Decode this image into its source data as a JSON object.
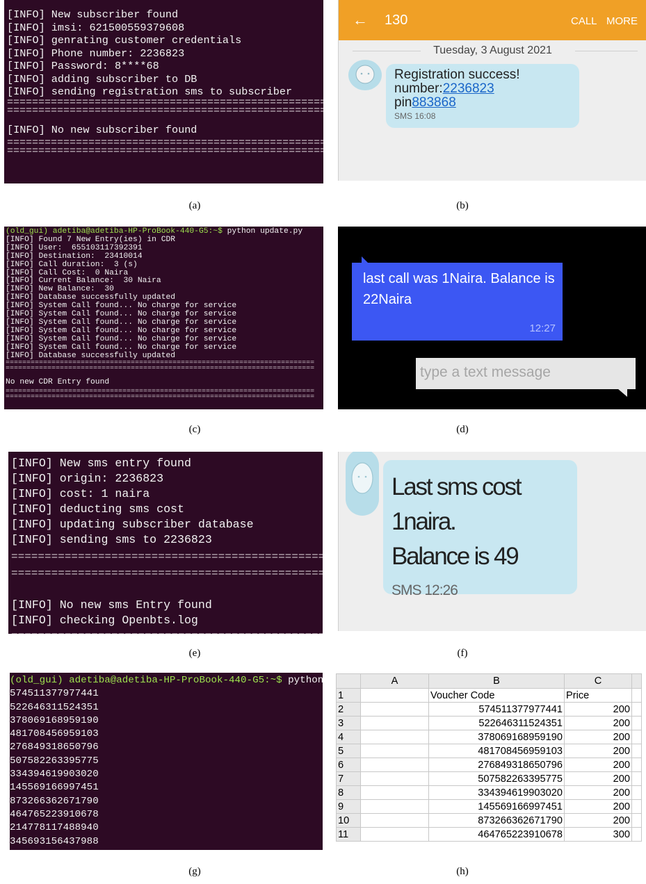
{
  "panel_a": {
    "lines": [
      "[INFO] New subscriber found",
      "[INFO] imsi: 621500559379608",
      "[INFO] genrating customer credentials",
      "[INFO] Phone number: 2236823",
      "[INFO] Password: 8****68",
      "[INFO] adding subscriber to DB",
      "[INFO] sending registration sms to subscriber"
    ],
    "after_separator": "[INFO] No new subscriber found"
  },
  "panel_b": {
    "sender": "130",
    "call_label": "CALL",
    "more_label": "MORE",
    "date": "Tuesday, 3 August 2021",
    "message_title": "Registration success!",
    "number_label": "number:",
    "number_value": "2236823",
    "pin_label": "pin",
    "pin_value": "883868",
    "sms_time": "SMS 16:08"
  },
  "panel_c": {
    "prompt_env": "(old_gui)",
    "prompt_user": "adetiba@adetiba-HP-ProBook-440-G5:~$",
    "command": "python update.py",
    "lines": [
      "[INFO] Found 7 New Entry(ies) in CDR",
      "[INFO] User:  655103117392391",
      "[INFO] Destination:  23410014",
      "[INFO] Call duration:  3 (s)",
      "[INFO] Call Cost:  0 Naira",
      "[INFO] Current Balance:  30 Naira",
      "[INFO] New Balance:  30",
      "[INFO] Database successfully updated",
      "[INFO] System Call found... No charge for service",
      "[INFO] System Call found... No charge for service",
      "[INFO] System Call found... No charge for service",
      "[INFO] System Call found... No charge for service",
      "[INFO] System Call found... No charge for service",
      "[INFO] System Call found... No charge for service",
      "[INFO] Database successfully updated"
    ],
    "after_separator": "No new CDR Entry found"
  },
  "panel_d": {
    "message": "last call was 1Naira. Balance is 22Naira",
    "time": "12:27",
    "input_placeholder": "type a text message"
  },
  "panel_e": {
    "lines": [
      "[INFO] New sms entry found",
      "[INFO] origin: 2236823",
      "[INFO] cost: 1 naira",
      "[INFO] deducting sms cost",
      "[INFO] updating subscriber database",
      "[INFO] sending sms to 2236823"
    ],
    "after_separator": [
      "[INFO] No new sms Entry found",
      "[INFO] checking Openbts.log"
    ]
  },
  "panel_f": {
    "message_line1": "Last sms cost 1naira.",
    "message_line2": "Balance is 49",
    "sms_time": "SMS 12:26"
  },
  "panel_g": {
    "prompt_env": "(old_gui)",
    "prompt_user": "adetiba@adetiba-HP-ProBook-440-G5:~$",
    "command": "python",
    "codes": [
      "574511377977441",
      "522646311524351",
      "378069168959190",
      "481708456959103",
      "276849318650796",
      "507582263395775",
      "334394619903020",
      "145569166997451",
      "873266362671790",
      "464765223910678",
      "214778117488940",
      "345693156437988"
    ]
  },
  "panel_h": {
    "columns": [
      "A",
      "B",
      "C"
    ],
    "header_row": {
      "num": "1",
      "b": "Voucher Code",
      "c": "Price"
    },
    "rows": [
      {
        "num": "2",
        "code": "574511377977441",
        "price": "200"
      },
      {
        "num": "3",
        "code": "522646311524351",
        "price": "200"
      },
      {
        "num": "4",
        "code": "378069168959190",
        "price": "200"
      },
      {
        "num": "5",
        "code": "481708456959103",
        "price": "200"
      },
      {
        "num": "6",
        "code": "276849318650796",
        "price": "200"
      },
      {
        "num": "7",
        "code": "507582263395775",
        "price": "200"
      },
      {
        "num": "8",
        "code": "334394619903020",
        "price": "200"
      },
      {
        "num": "9",
        "code": "145569166997451",
        "price": "200"
      },
      {
        "num": "10",
        "code": "873266362671790",
        "price": "200"
      },
      {
        "num": "11",
        "code": "464765223910678",
        "price": "300"
      }
    ]
  },
  "captions": {
    "a": "(a)",
    "b": "(b)",
    "c": "(c)",
    "d": "(d)",
    "e": "(e)",
    "f": "(f)",
    "g": "(g)",
    "h": "(h)"
  },
  "colors": {
    "terminal_bg": "#2d0a24",
    "prompt_green": "#9ee04f",
    "appbar_orange": "#f0a026",
    "bubble_blue": "#c8e7f1",
    "dark_bubble": "#3c57f3"
  }
}
